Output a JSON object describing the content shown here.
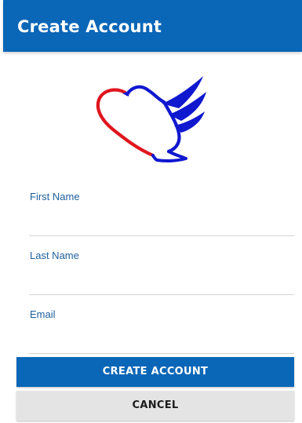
{
  "header": {
    "title": "Create Account",
    "background_color": "#0a66b7"
  },
  "logo": {
    "icon": "dove-heart-logo",
    "colors": [
      "#e0161e",
      "#1018cf"
    ]
  },
  "form": {
    "fields": [
      {
        "label": "First Name",
        "value": ""
      },
      {
        "label": "Last Name",
        "value": ""
      },
      {
        "label": "Email",
        "value": ""
      }
    ]
  },
  "actions": {
    "create_label": "CREATE ACCOUNT",
    "cancel_label": "CANCEL",
    "primary_color": "#0a66b7",
    "secondary_color": "#e4e4e4"
  }
}
